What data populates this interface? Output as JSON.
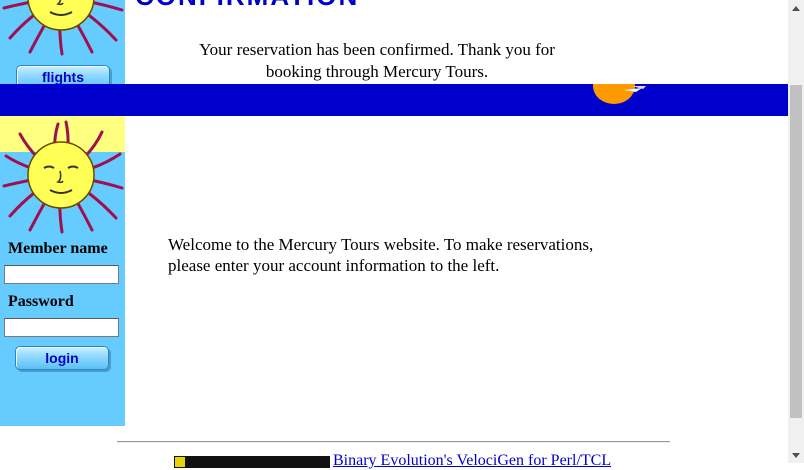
{
  "header": {
    "heading_partial": "CONFIRMATION",
    "confirmation_text": "Your reservation has been confirmed. Thank you for booking through Mercury Tours."
  },
  "sidebar_top": {
    "flights_button": "flights"
  },
  "sidebar": {
    "member_name_label": "Member name",
    "password_label": "Password",
    "login_button": "login",
    "member_value": "",
    "password_value": ""
  },
  "main": {
    "welcome_text": "Welcome to the Mercury Tours website. To make reservations, please enter your account information to the left."
  },
  "footer": {
    "link_text": "Binary Evolution's VelociGen for Perl/TCL"
  },
  "colors": {
    "sidebar_bg": "#66ccff",
    "stripe": "#0000cc",
    "link": "#0000cc"
  },
  "icons": {
    "sun": "sun-logo-icon",
    "scroll_up": "scroll-up-icon",
    "scroll_down": "scroll-down-icon"
  }
}
